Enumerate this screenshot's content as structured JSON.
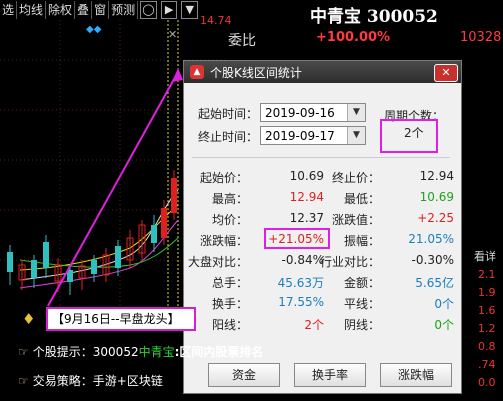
{
  "toolbar": {
    "items": [
      "选",
      "均线",
      "除权",
      "叠",
      "窗",
      "预测"
    ],
    "price_top": "14.74"
  },
  "header": {
    "stock_title": "中青宝 300052",
    "weibi_label": "委比",
    "weibi_value": "+100.00%",
    "weibi_right": "10328"
  },
  "dialog": {
    "title": "个股K线区间统计",
    "start_label": "起始时间：",
    "start_value": "2019-09-16",
    "end_label": "终止时间：",
    "end_value": "2019-09-17",
    "period_label": "周期个数：",
    "period_value": "2个",
    "stats_left": [
      {
        "label": "起始价：",
        "value": "10.69",
        "color": "#222222"
      },
      {
        "label": "最高：",
        "value": "12.94",
        "color": "#e02020"
      },
      {
        "label": "均价：",
        "value": "12.37",
        "color": "#222222"
      },
      {
        "label": "涨跌幅：",
        "value": "+21.05%",
        "color": "#e02020"
      },
      {
        "label": "大盘对比：",
        "value": "-0.84%",
        "color": "#222222"
      },
      {
        "label": "总手：",
        "value": "45.63万",
        "color": "#1a7fc0"
      },
      {
        "label": "换手：",
        "value": "17.55%",
        "color": "#1a7fc0"
      },
      {
        "label": "阳线：",
        "value": "2个",
        "color": "#e02020"
      }
    ],
    "stats_right": [
      {
        "label": "终止价：",
        "value": "12.94",
        "color": "#222222"
      },
      {
        "label": "最低：",
        "value": "10.69",
        "color": "#20a020"
      },
      {
        "label": "涨跌值：",
        "value": "+2.25",
        "color": "#e02020"
      },
      {
        "label": "振幅：",
        "value": "21.05%",
        "color": "#1a7fc0"
      },
      {
        "label": "行业对比：",
        "value": "-0.30%",
        "color": "#222222"
      },
      {
        "label": "金额：",
        "value": "5.65亿",
        "color": "#1a7fc0"
      },
      {
        "label": "平线：",
        "value": "0个",
        "color": "#1a7fc0"
      },
      {
        "label": "阴线：",
        "value": "0个",
        "color": "#20a020"
      }
    ],
    "buttons": [
      "资金",
      "换手率",
      "涨跌幅"
    ]
  },
  "annotations": {
    "note": "【9月16日--早盘龙头】",
    "hint1_label": "个股提示：",
    "hint1_code": "300052",
    "hint1_name": "中青宝",
    "hint1_text": ":区间内股票排名",
    "hint2_label": "交易策略：",
    "hint2_text": "手游+区块链"
  },
  "right_edge": [
    "看详",
    "2.1",
    "1.9",
    "1.6",
    "1.2",
    "0.8",
    ".74",
    "0.0"
  ],
  "colors": {
    "up": "#e02020",
    "down": "#20a020",
    "highlight": "#e020e0"
  }
}
